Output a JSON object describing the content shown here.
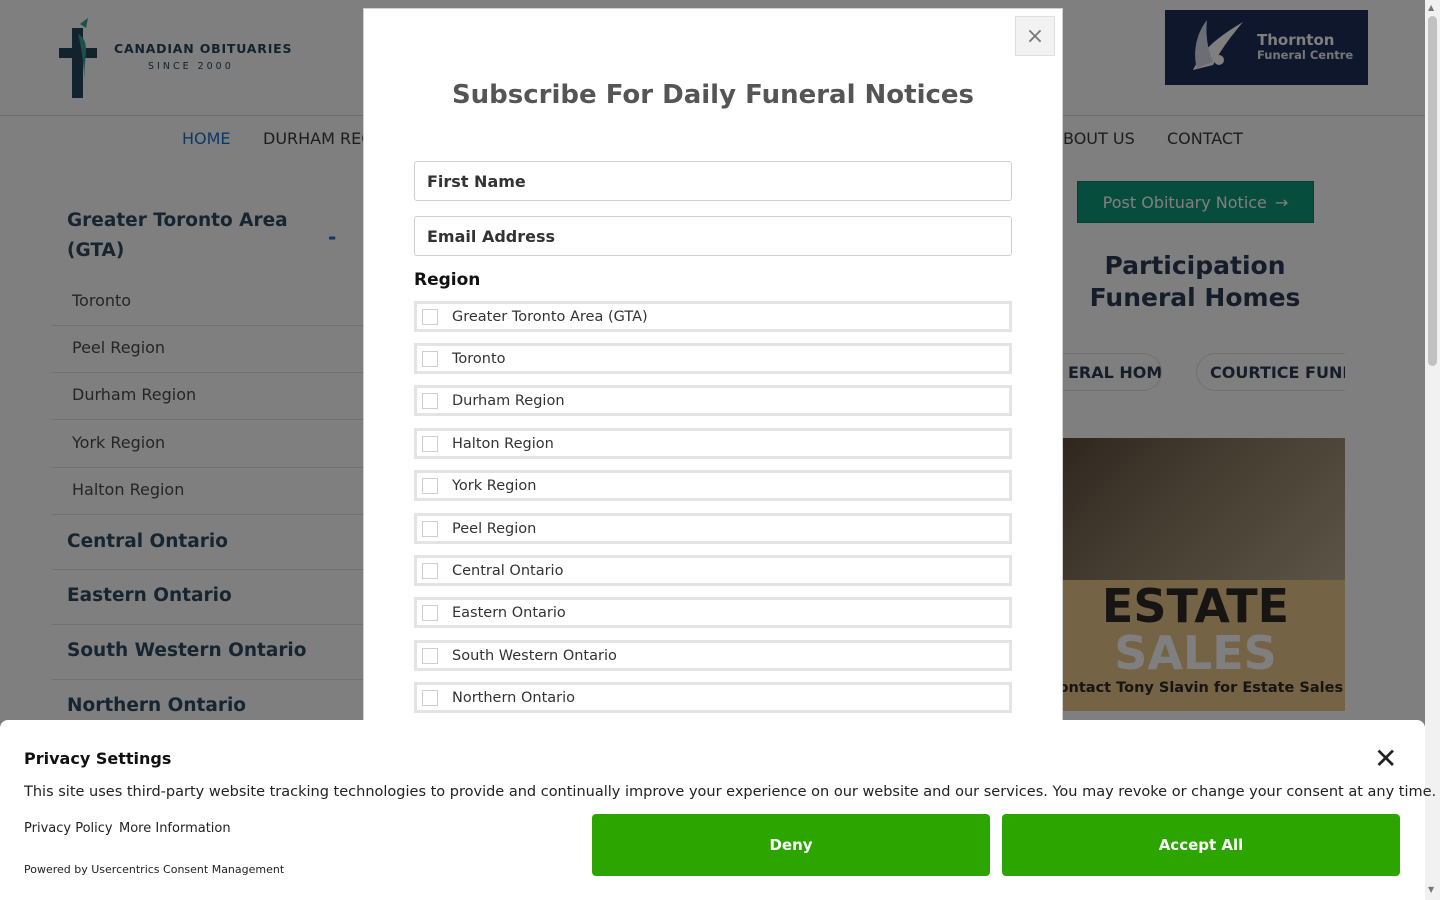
{
  "header": {
    "logo_line1": "CANADIAN OBITUARIES",
    "logo_line2": "SINCE 2000",
    "sponsor_name": "Thornton",
    "sponsor_sub": "Funeral Centre"
  },
  "nav": {
    "items": [
      "HOME",
      "DURHAM REG",
      "BOUT US",
      "CONTACT"
    ]
  },
  "sidebar": {
    "group_gta": "Greater Toronto Area (GTA)",
    "toggle": "-",
    "sub_items": [
      "Toronto",
      "Peel Region",
      "Durham Region",
      "York Region",
      "Halton Region"
    ],
    "groups": [
      "Central Ontario",
      "Eastern Ontario",
      "South Western Ontario",
      "Northern Ontario"
    ]
  },
  "right": {
    "post_button": "Post Obituary Notice",
    "participation_title": "Participation Funeral Homes",
    "pills": [
      "ERAL HOME",
      "COURTICE FUNEF"
    ],
    "ad_estate": "ESTATE",
    "ad_sales": "SALES",
    "ad_contact": "Contact Tony Slavin for Estate Sales"
  },
  "modal": {
    "title": "Subscribe For Daily Funeral Notices",
    "close": "×",
    "first_name_placeholder": "First Name",
    "email_placeholder": "Email Address",
    "region_label": "Region",
    "regions": [
      "Greater Toronto Area (GTA)",
      "Toronto",
      "Durham Region",
      "Halton Region",
      "York Region",
      "Peel Region",
      "Central Ontario",
      "Eastern Ontario",
      "South Western Ontario",
      "Northern Ontario"
    ]
  },
  "consent": {
    "title": "Privacy Settings",
    "text": "This site uses third-party website tracking technologies to provide and continually improve your experience on our website and our services. You may revoke or change your consent at any time.",
    "privacy_policy": "Privacy Policy",
    "more_info": "More Information",
    "powered_by": "Powered by Usercentrics Consent Management",
    "deny": "Deny",
    "accept_all": "Accept All",
    "close": "✕"
  },
  "colors": {
    "accept_green": "#2da500",
    "post_button_teal": "#0f9b7a",
    "nav_active_blue": "#1c6fc7"
  }
}
